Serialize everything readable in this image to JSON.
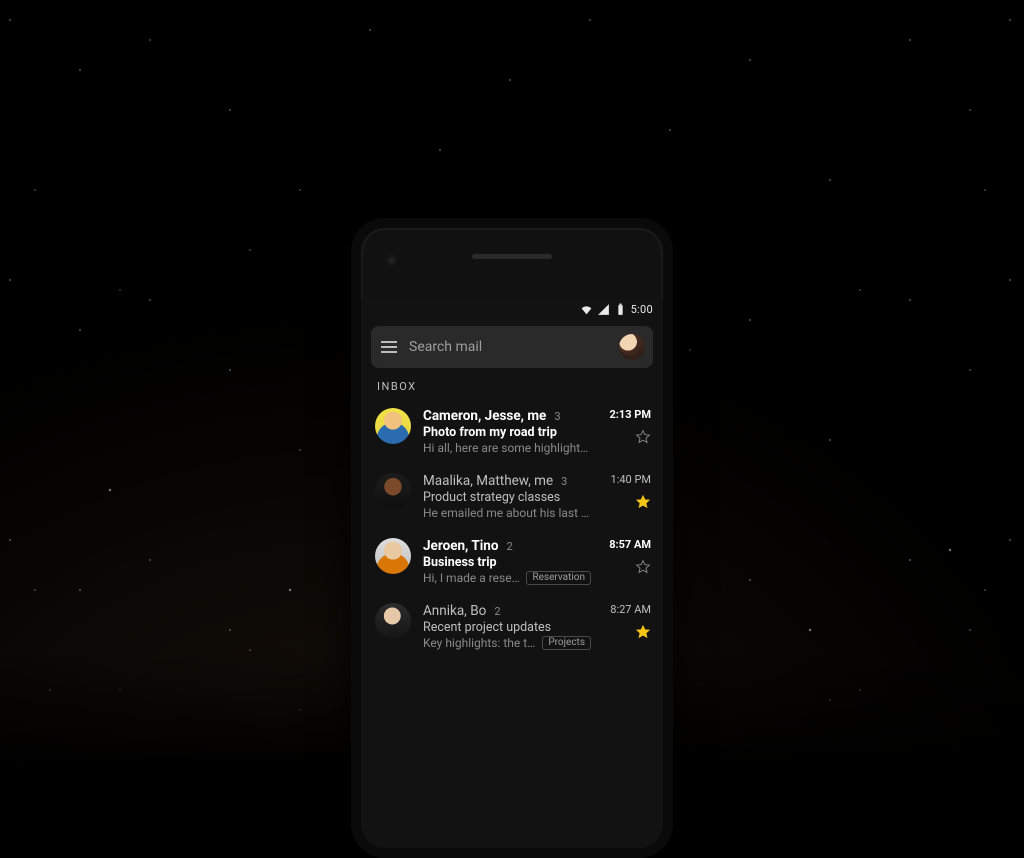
{
  "statusbar": {
    "time": "5:00"
  },
  "search": {
    "placeholder": "Search mail"
  },
  "section": {
    "label": "INBOX"
  },
  "emails": [
    {
      "senders": "Cameron, Jesse, me",
      "count": "3",
      "time": "2:13 PM",
      "subject": "Photo from my road trip",
      "snippet": "Hi all, here are some highlights fr…",
      "chip": "",
      "starred": false,
      "unread": true,
      "avatar_class": "cameron"
    },
    {
      "senders": "Maalika, Matthew, me",
      "count": "3",
      "time": "1:40 PM",
      "subject": "Product strategy classes",
      "snippet": "He emailed me about his last pro…",
      "chip": "",
      "starred": true,
      "unread": false,
      "avatar_class": "maalika"
    },
    {
      "senders": "Jeroen, Tino",
      "count": "2",
      "time": "8:57 AM",
      "subject": "Business trip",
      "snippet": "Hi, I made a reservation…",
      "chip": "Reservation",
      "starred": false,
      "unread": true,
      "avatar_class": "jeroen"
    },
    {
      "senders": "Annika, Bo",
      "count": "2",
      "time": "8:27 AM",
      "subject": "Recent project updates",
      "snippet": "Key highlights: the team h…",
      "chip": "Projects",
      "starred": true,
      "unread": false,
      "avatar_class": "annika"
    }
  ]
}
